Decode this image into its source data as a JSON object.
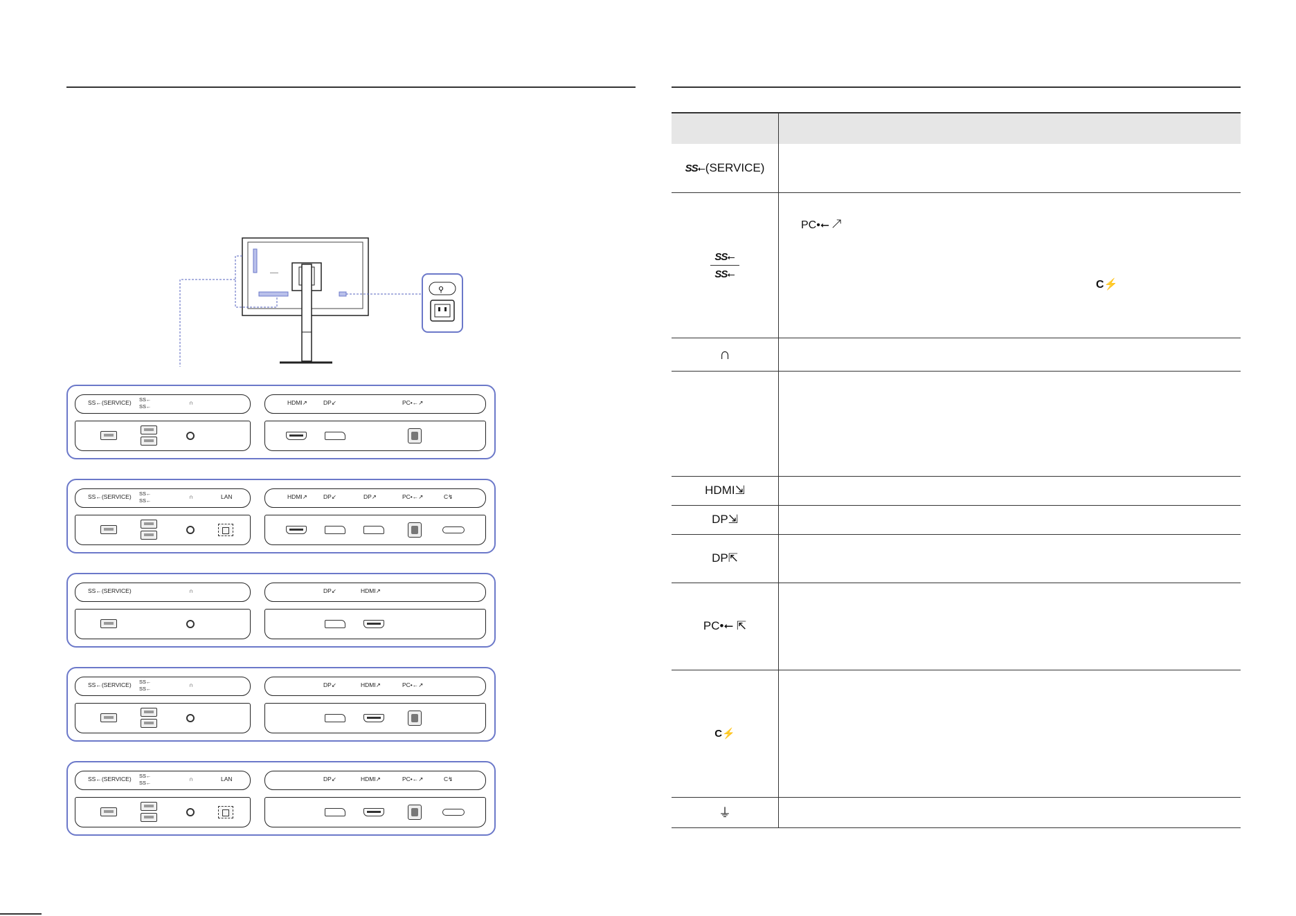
{
  "ports": [
    {
      "id": "usb-service",
      "label": "(SERVICE)"
    },
    {
      "id": "usb-downstream",
      "label": ""
    },
    {
      "id": "headphone",
      "label": ""
    },
    {
      "id": "lan",
      "label": ""
    },
    {
      "id": "hdmi-in",
      "label": "HDMI"
    },
    {
      "id": "dp-in",
      "label": "DP"
    },
    {
      "id": "dp-out",
      "label": "DP"
    },
    {
      "id": "usb-upstream-pc",
      "label": "PC"
    },
    {
      "id": "usb-c",
      "label": ""
    },
    {
      "id": "power",
      "label": ""
    }
  ],
  "desc_symbols": {
    "pc_usb": "PC",
    "usbc": ""
  },
  "panel_labels": {
    "service": "SS←(SERVICE)",
    "ss_top": "SS←",
    "ss_bottom": "SS←",
    "lan": "LAN",
    "hdmi": "HDMI↗",
    "dp_in": "DP↙",
    "dp_out": "DP↗",
    "pc": "PC•←↗",
    "usbc": "C↯"
  },
  "monitor_label": "——"
}
